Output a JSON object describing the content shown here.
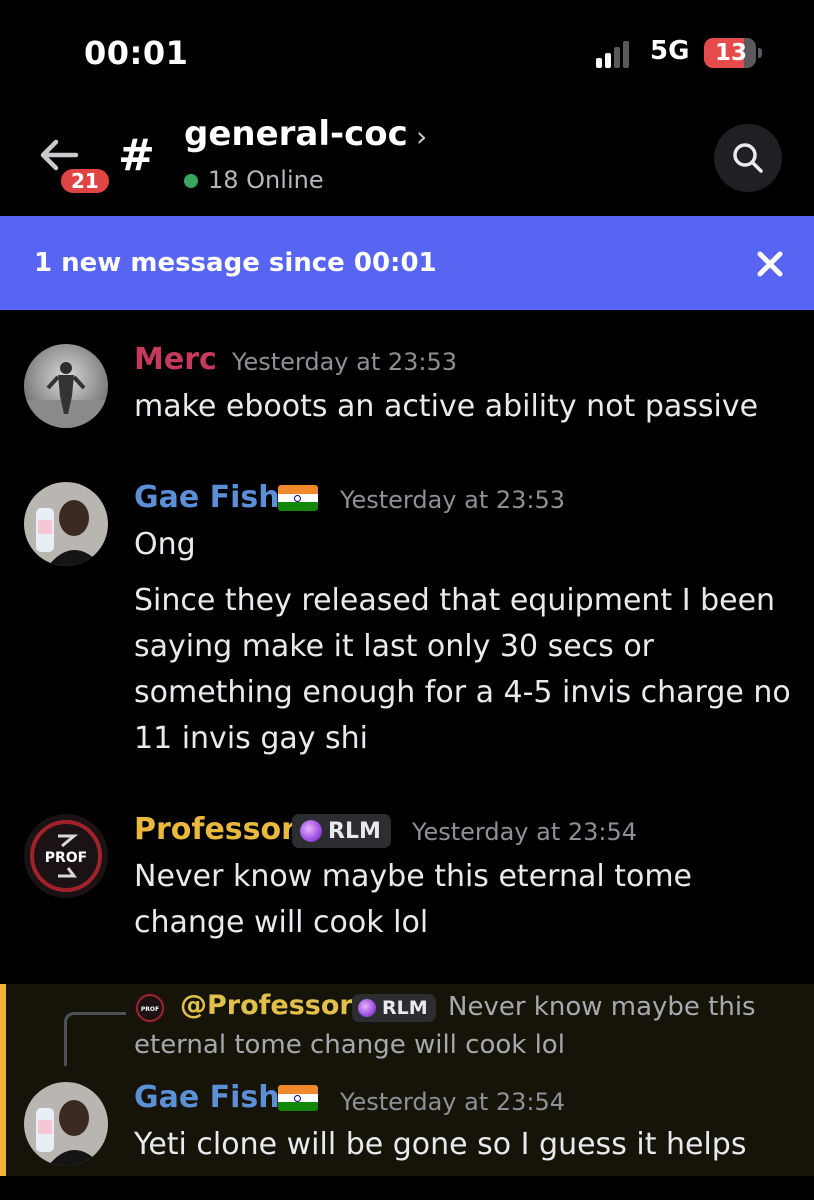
{
  "status_bar": {
    "time": "00:01",
    "network": "5G",
    "battery": "13"
  },
  "header": {
    "back_badge": "21",
    "channel_name": "general-coc",
    "online": "18 Online"
  },
  "banner": {
    "text": "1 new message since 00:01"
  },
  "messages": [
    {
      "username": "Merc",
      "username_color": "#c43a5c",
      "timestamp": "Yesterday at 23:53",
      "lines": [
        "make eboots an active ability not passive"
      ]
    },
    {
      "username": "Gae Fish",
      "username_color": "#5b8fd6",
      "flag": "india-flag",
      "timestamp": "Yesterday at 23:53",
      "lines": [
        "Ong",
        "Since they released that equipment I been",
        "saying make it last only 30 secs or",
        "something enough for a 4-5 invis charge no",
        "11 invis gay shi"
      ]
    },
    {
      "username": "Professor",
      "username_color": "#e8b93c",
      "role_tag": "RLM",
      "avatar_text": "PROF",
      "timestamp": "Yesterday at 23:54",
      "lines": [
        "Never know maybe this eternal tome",
        "change will cook lol"
      ]
    },
    {
      "username": "Gae Fish",
      "username_color": "#5b8fd6",
      "flag": "india-flag",
      "timestamp": "Yesterday at 23:54",
      "reply": {
        "username": "@Professor",
        "role_tag": "RLM",
        "avatar_text": "PROF",
        "snippet_line1": "Never know maybe this",
        "snippet_line2": "eternal tome change will cook lol"
      },
      "lines": [
        "Yeti clone will be gone so I guess it helps"
      ]
    }
  ]
}
